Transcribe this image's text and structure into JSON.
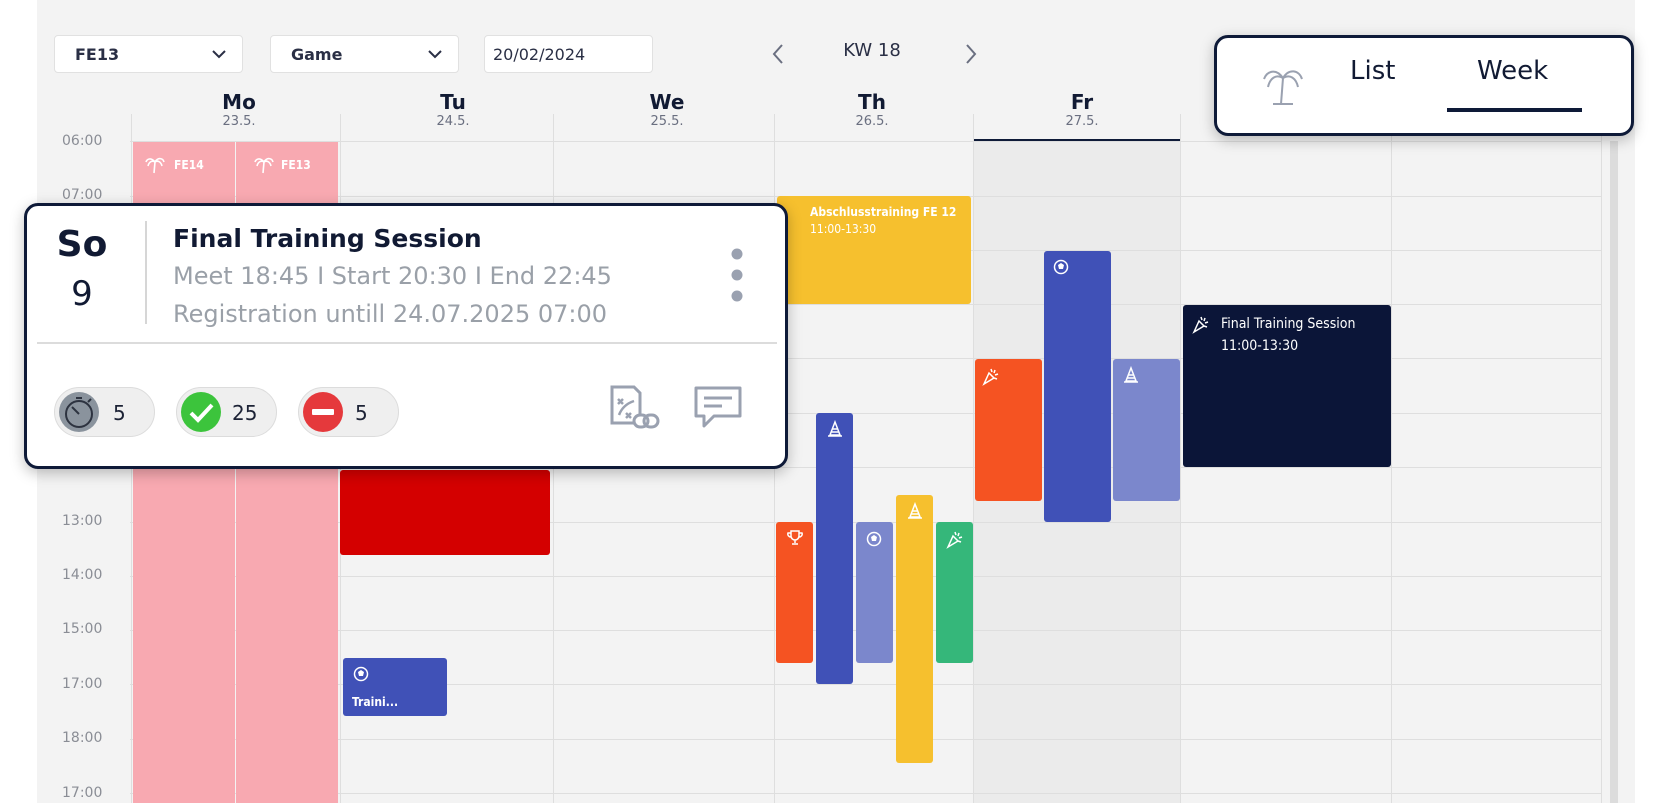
{
  "filters": {
    "team": "FE13",
    "type": "Game",
    "date": "20/02/2024"
  },
  "week_nav": {
    "label": "KW 18"
  },
  "days": [
    {
      "name": "Mo",
      "date": "23.5."
    },
    {
      "name": "Tu",
      "date": "24.5."
    },
    {
      "name": "We",
      "date": "25.5."
    },
    {
      "name": "Th",
      "date": "26.5."
    },
    {
      "name": "Fr",
      "date": "27.5."
    }
  ],
  "time_labels": [
    "06:00",
    "07:00",
    "13:00",
    "14:00",
    "15:00",
    "17:00",
    "18:00",
    "17:00"
  ],
  "events": {
    "holiday_fe14": "FE14",
    "holiday_fe13": "FE13",
    "abschluss_title": "Abschlusstraining FE 12",
    "abschluss_time": "11:00-13:30",
    "training_short": "Traini...",
    "final_title": "Final Training Session",
    "final_time": "11:00-13:30"
  },
  "view_toggle": {
    "list_label": "List",
    "week_label": "Week",
    "active": "Week"
  },
  "detail_card": {
    "day_abbr": "So",
    "day_num": "9",
    "title": "Final Training Session",
    "times": "Meet 18:45 I Start 20:30 I End 22:45",
    "registration": "Registration untill 24.07.2025 07:00",
    "pending_count": "5",
    "accepted_count": "25",
    "declined_count": "5"
  },
  "colors": {
    "navy": "#0e1a38",
    "holiday": "#f8a9b1",
    "red": "#d40000",
    "orange": "#f55322",
    "blue": "#4051b7",
    "lavender": "#7b87cc",
    "yellow": "#f6c02e",
    "green": "#35b77a",
    "dark": "#0b1538",
    "accept": "#3cc43c",
    "decline": "#e5393c",
    "pending": "#8a939d"
  }
}
